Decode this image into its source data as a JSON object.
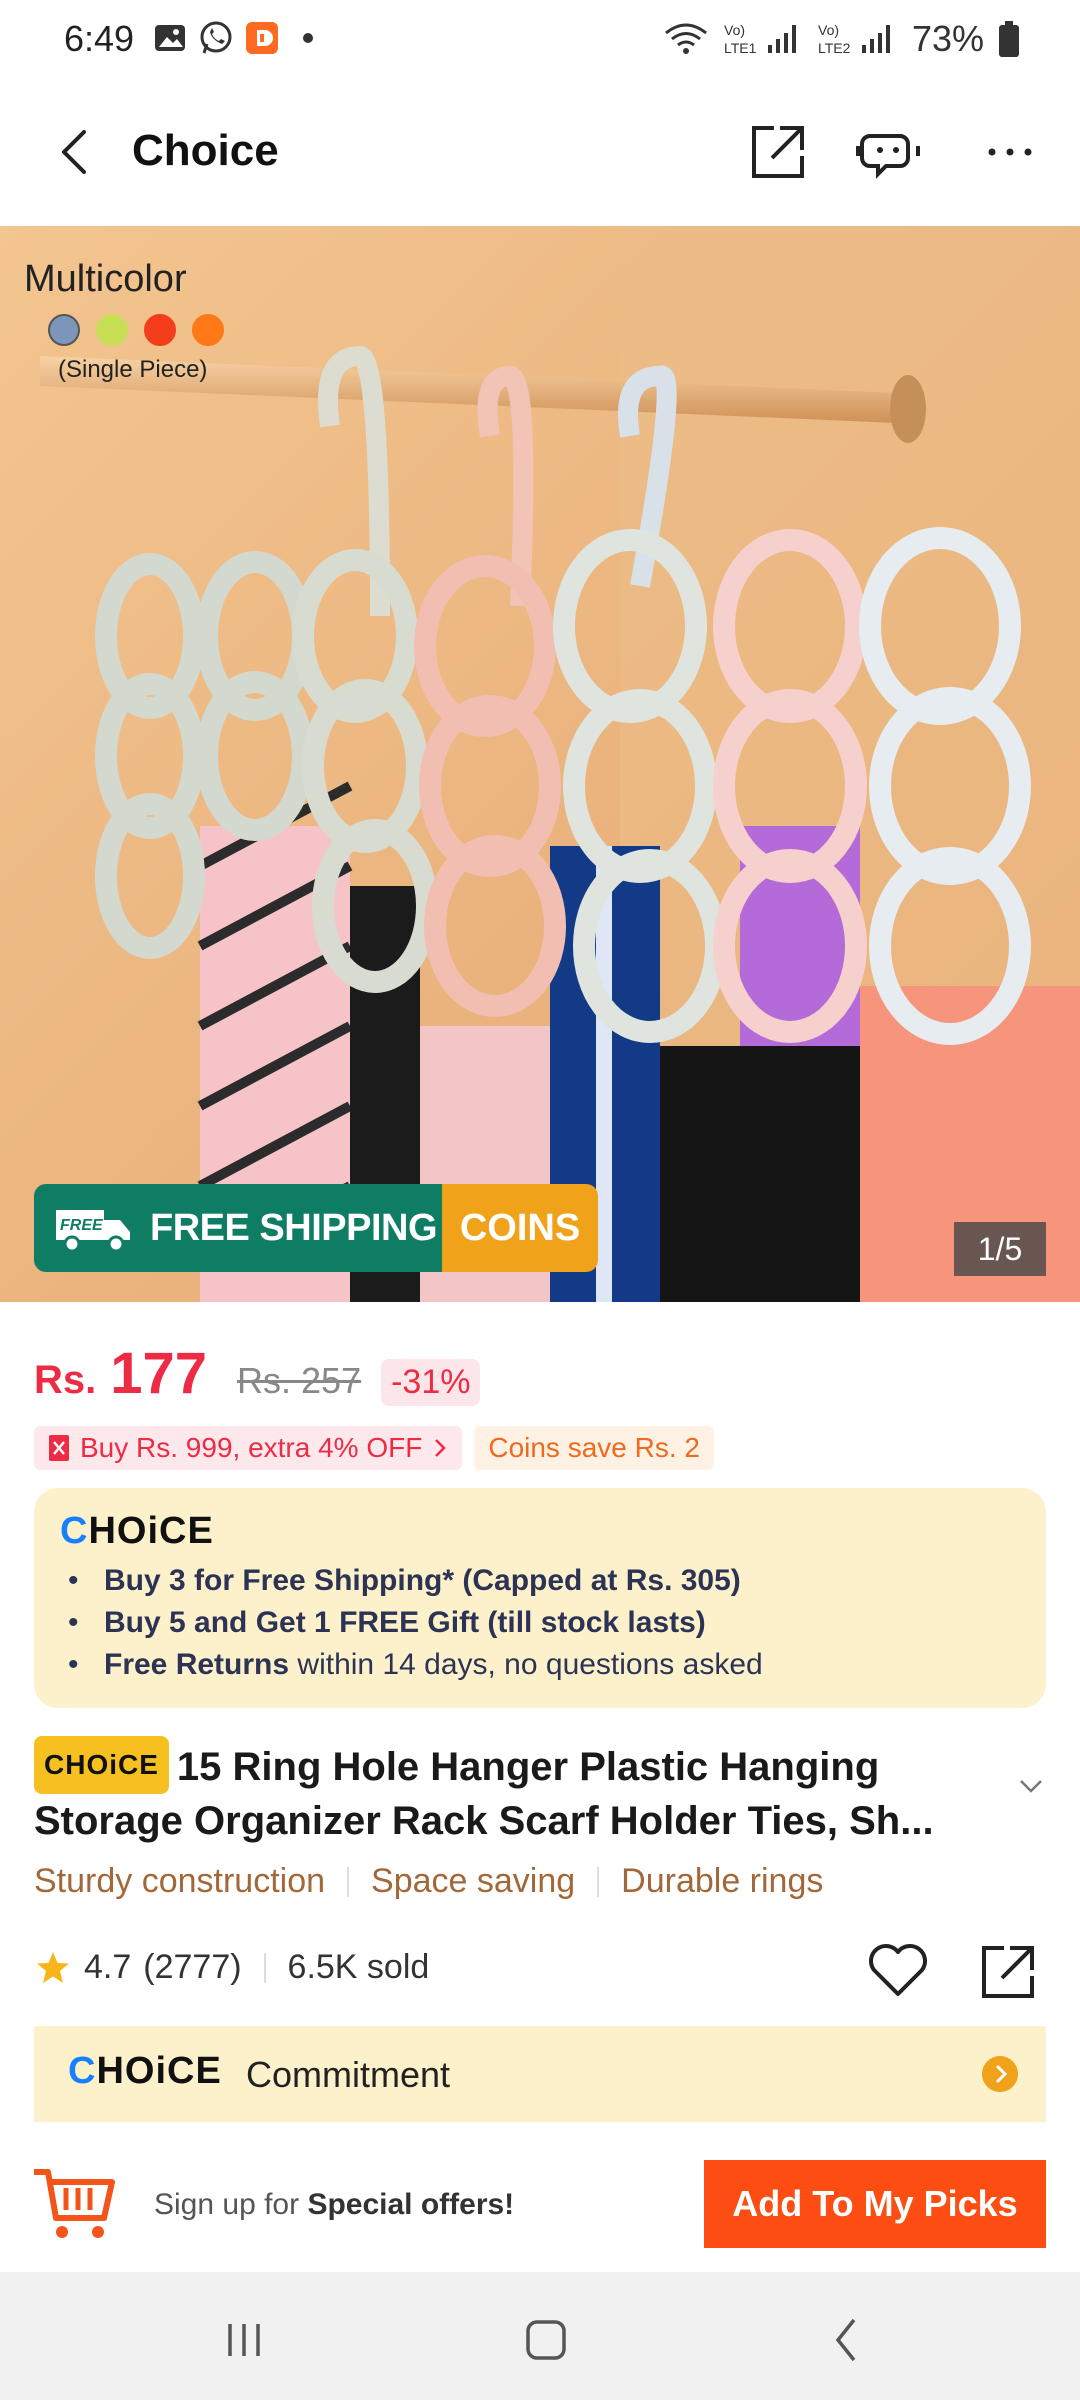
{
  "status_bar": {
    "time": "6:49",
    "battery": "73%",
    "net1": "Vo) LTE1",
    "net2": "Vo) LTE2"
  },
  "header": {
    "title": "Choice",
    "icons": [
      "back-icon",
      "share-icon",
      "chat-robot-icon",
      "more-icon"
    ]
  },
  "hero": {
    "variant_title": "Multicolor",
    "variant_sub": "(Single Piece)",
    "swatches": [
      "#7d95b8",
      "#c8df55",
      "#f43d1a",
      "#ff7a16"
    ],
    "free_badge": "FREE",
    "free_shipping": "FREE SHIPPING",
    "coins": "COINS",
    "counter": "1/5"
  },
  "price": {
    "currency": "Rs.",
    "value": "177",
    "old": "Rs. 257",
    "discount": "-31%"
  },
  "promos": {
    "bulk": "Buy Rs. 999, extra 4% OFF",
    "coins": "Coins save Rs. 2"
  },
  "choice": {
    "logo_c": "C",
    "logo_rest": "HOiCE",
    "items": [
      {
        "bold": "Buy 3 for  Free Shipping* (Capped at Rs. 305)",
        "rest": ""
      },
      {
        "bold": "Buy 5 and Get 1 FREE Gift (till stock lasts)",
        "rest": ""
      },
      {
        "bold": "Free Returns",
        "rest": " within 14 days, no questions asked"
      }
    ]
  },
  "product": {
    "badge": "CHOiCE",
    "title": "15 Ring Hole Hanger Plastic Hanging Storage Organizer Rack Scarf Holder Ties, Sh...",
    "features": [
      "Sturdy construction",
      "Space saving",
      "Durable rings"
    ],
    "rating": "4.7",
    "reviews": "(2777)",
    "sold": "6.5K sold"
  },
  "commitment": {
    "logo_c": "C",
    "logo_rest": "HOiCE",
    "text": "Commitment"
  },
  "bottom": {
    "signup_prefix": "Sign up for ",
    "signup_bold": "Special offers!",
    "button": "Add To My Picks"
  },
  "colors": {
    "price_red": "#ee2b45",
    "accent_orange": "#fd4d12",
    "choice_bg": "#fdf1cc",
    "shipping_green": "#0f7d63",
    "coins_orange": "#f0a21a"
  }
}
